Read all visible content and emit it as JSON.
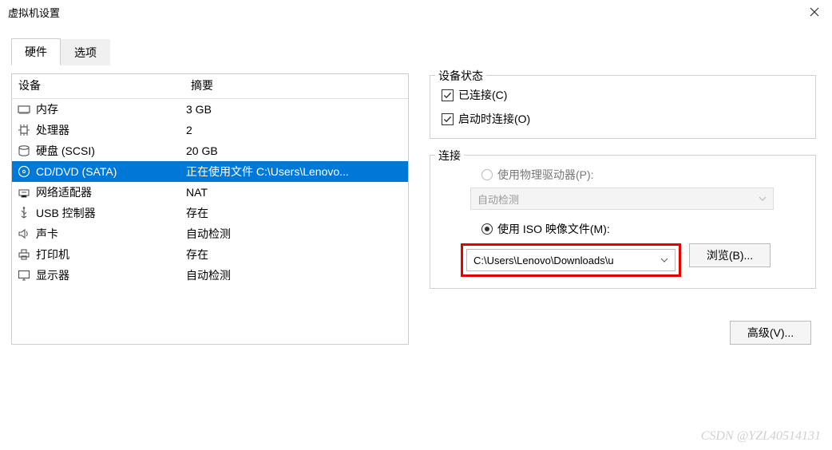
{
  "window": {
    "title": "虚拟机设置"
  },
  "tabs": {
    "hardware": "硬件",
    "options": "选项"
  },
  "deviceTable": {
    "headers": {
      "device": "设备",
      "summary": "摘要"
    },
    "rows": [
      {
        "icon": "memory",
        "name": "内存",
        "summary": "3 GB",
        "selected": false
      },
      {
        "icon": "cpu",
        "name": "处理器",
        "summary": "2",
        "selected": false
      },
      {
        "icon": "disk",
        "name": "硬盘 (SCSI)",
        "summary": "20 GB",
        "selected": false
      },
      {
        "icon": "disc",
        "name": "CD/DVD (SATA)",
        "summary": "正在使用文件 C:\\Users\\Lenovo...",
        "selected": true
      },
      {
        "icon": "net",
        "name": "网络适配器",
        "summary": "NAT",
        "selected": false
      },
      {
        "icon": "usb",
        "name": "USB 控制器",
        "summary": "存在",
        "selected": false
      },
      {
        "icon": "sound",
        "name": "声卡",
        "summary": "自动检测",
        "selected": false
      },
      {
        "icon": "printer",
        "name": "打印机",
        "summary": "存在",
        "selected": false
      },
      {
        "icon": "display",
        "name": "显示器",
        "summary": "自动检测",
        "selected": false
      }
    ]
  },
  "deviceStatus": {
    "title": "设备状态",
    "connected": "已连接(C)",
    "connectOnStart": "启动时连接(O)"
  },
  "connection": {
    "title": "连接",
    "physical": "使用物理驱动器(P):",
    "physicalValue": "自动检测",
    "iso": "使用 ISO 映像文件(M):",
    "isoPath": "C:\\Users\\Lenovo\\Downloads\\u",
    "browse": "浏览(B)..."
  },
  "advanced": "高级(V)...",
  "watermark": "CSDN @YZL40514131"
}
